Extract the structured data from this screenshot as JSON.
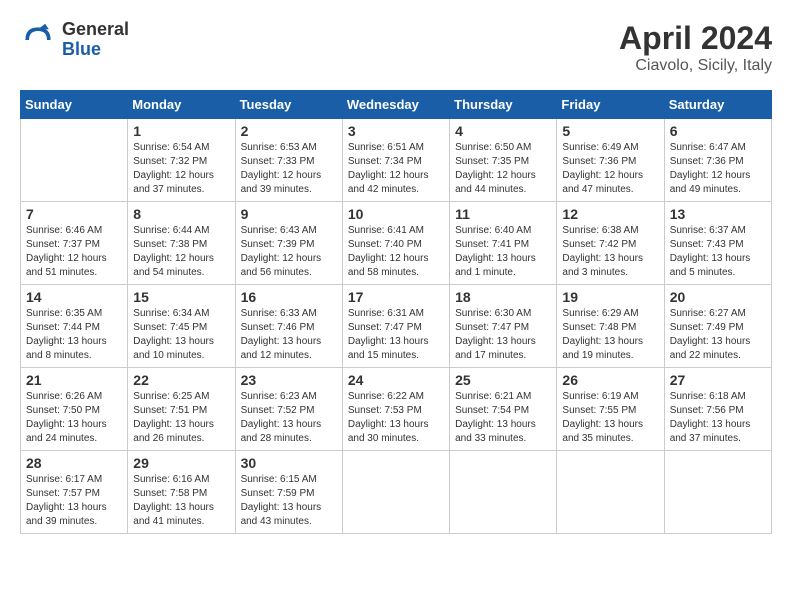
{
  "header": {
    "logo_general": "General",
    "logo_blue": "Blue",
    "month_title": "April 2024",
    "location": "Ciavolo, Sicily, Italy"
  },
  "calendar": {
    "days_of_week": [
      "Sunday",
      "Monday",
      "Tuesday",
      "Wednesday",
      "Thursday",
      "Friday",
      "Saturday"
    ],
    "weeks": [
      [
        {
          "day": "",
          "sunrise": "",
          "sunset": "",
          "daylight": ""
        },
        {
          "day": "1",
          "sunrise": "Sunrise: 6:54 AM",
          "sunset": "Sunset: 7:32 PM",
          "daylight": "Daylight: 12 hours and 37 minutes."
        },
        {
          "day": "2",
          "sunrise": "Sunrise: 6:53 AM",
          "sunset": "Sunset: 7:33 PM",
          "daylight": "Daylight: 12 hours and 39 minutes."
        },
        {
          "day": "3",
          "sunrise": "Sunrise: 6:51 AM",
          "sunset": "Sunset: 7:34 PM",
          "daylight": "Daylight: 12 hours and 42 minutes."
        },
        {
          "day": "4",
          "sunrise": "Sunrise: 6:50 AM",
          "sunset": "Sunset: 7:35 PM",
          "daylight": "Daylight: 12 hours and 44 minutes."
        },
        {
          "day": "5",
          "sunrise": "Sunrise: 6:49 AM",
          "sunset": "Sunset: 7:36 PM",
          "daylight": "Daylight: 12 hours and 47 minutes."
        },
        {
          "day": "6",
          "sunrise": "Sunrise: 6:47 AM",
          "sunset": "Sunset: 7:36 PM",
          "daylight": "Daylight: 12 hours and 49 minutes."
        }
      ],
      [
        {
          "day": "7",
          "sunrise": "Sunrise: 6:46 AM",
          "sunset": "Sunset: 7:37 PM",
          "daylight": "Daylight: 12 hours and 51 minutes."
        },
        {
          "day": "8",
          "sunrise": "Sunrise: 6:44 AM",
          "sunset": "Sunset: 7:38 PM",
          "daylight": "Daylight: 12 hours and 54 minutes."
        },
        {
          "day": "9",
          "sunrise": "Sunrise: 6:43 AM",
          "sunset": "Sunset: 7:39 PM",
          "daylight": "Daylight: 12 hours and 56 minutes."
        },
        {
          "day": "10",
          "sunrise": "Sunrise: 6:41 AM",
          "sunset": "Sunset: 7:40 PM",
          "daylight": "Daylight: 12 hours and 58 minutes."
        },
        {
          "day": "11",
          "sunrise": "Sunrise: 6:40 AM",
          "sunset": "Sunset: 7:41 PM",
          "daylight": "Daylight: 13 hours and 1 minute."
        },
        {
          "day": "12",
          "sunrise": "Sunrise: 6:38 AM",
          "sunset": "Sunset: 7:42 PM",
          "daylight": "Daylight: 13 hours and 3 minutes."
        },
        {
          "day": "13",
          "sunrise": "Sunrise: 6:37 AM",
          "sunset": "Sunset: 7:43 PM",
          "daylight": "Daylight: 13 hours and 5 minutes."
        }
      ],
      [
        {
          "day": "14",
          "sunrise": "Sunrise: 6:35 AM",
          "sunset": "Sunset: 7:44 PM",
          "daylight": "Daylight: 13 hours and 8 minutes."
        },
        {
          "day": "15",
          "sunrise": "Sunrise: 6:34 AM",
          "sunset": "Sunset: 7:45 PM",
          "daylight": "Daylight: 13 hours and 10 minutes."
        },
        {
          "day": "16",
          "sunrise": "Sunrise: 6:33 AM",
          "sunset": "Sunset: 7:46 PM",
          "daylight": "Daylight: 13 hours and 12 minutes."
        },
        {
          "day": "17",
          "sunrise": "Sunrise: 6:31 AM",
          "sunset": "Sunset: 7:47 PM",
          "daylight": "Daylight: 13 hours and 15 minutes."
        },
        {
          "day": "18",
          "sunrise": "Sunrise: 6:30 AM",
          "sunset": "Sunset: 7:47 PM",
          "daylight": "Daylight: 13 hours and 17 minutes."
        },
        {
          "day": "19",
          "sunrise": "Sunrise: 6:29 AM",
          "sunset": "Sunset: 7:48 PM",
          "daylight": "Daylight: 13 hours and 19 minutes."
        },
        {
          "day": "20",
          "sunrise": "Sunrise: 6:27 AM",
          "sunset": "Sunset: 7:49 PM",
          "daylight": "Daylight: 13 hours and 22 minutes."
        }
      ],
      [
        {
          "day": "21",
          "sunrise": "Sunrise: 6:26 AM",
          "sunset": "Sunset: 7:50 PM",
          "daylight": "Daylight: 13 hours and 24 minutes."
        },
        {
          "day": "22",
          "sunrise": "Sunrise: 6:25 AM",
          "sunset": "Sunset: 7:51 PM",
          "daylight": "Daylight: 13 hours and 26 minutes."
        },
        {
          "day": "23",
          "sunrise": "Sunrise: 6:23 AM",
          "sunset": "Sunset: 7:52 PM",
          "daylight": "Daylight: 13 hours and 28 minutes."
        },
        {
          "day": "24",
          "sunrise": "Sunrise: 6:22 AM",
          "sunset": "Sunset: 7:53 PM",
          "daylight": "Daylight: 13 hours and 30 minutes."
        },
        {
          "day": "25",
          "sunrise": "Sunrise: 6:21 AM",
          "sunset": "Sunset: 7:54 PM",
          "daylight": "Daylight: 13 hours and 33 minutes."
        },
        {
          "day": "26",
          "sunrise": "Sunrise: 6:19 AM",
          "sunset": "Sunset: 7:55 PM",
          "daylight": "Daylight: 13 hours and 35 minutes."
        },
        {
          "day": "27",
          "sunrise": "Sunrise: 6:18 AM",
          "sunset": "Sunset: 7:56 PM",
          "daylight": "Daylight: 13 hours and 37 minutes."
        }
      ],
      [
        {
          "day": "28",
          "sunrise": "Sunrise: 6:17 AM",
          "sunset": "Sunset: 7:57 PM",
          "daylight": "Daylight: 13 hours and 39 minutes."
        },
        {
          "day": "29",
          "sunrise": "Sunrise: 6:16 AM",
          "sunset": "Sunset: 7:58 PM",
          "daylight": "Daylight: 13 hours and 41 minutes."
        },
        {
          "day": "30",
          "sunrise": "Sunrise: 6:15 AM",
          "sunset": "Sunset: 7:59 PM",
          "daylight": "Daylight: 13 hours and 43 minutes."
        },
        {
          "day": "",
          "sunrise": "",
          "sunset": "",
          "daylight": ""
        },
        {
          "day": "",
          "sunrise": "",
          "sunset": "",
          "daylight": ""
        },
        {
          "day": "",
          "sunrise": "",
          "sunset": "",
          "daylight": ""
        },
        {
          "day": "",
          "sunrise": "",
          "sunset": "",
          "daylight": ""
        }
      ]
    ]
  }
}
